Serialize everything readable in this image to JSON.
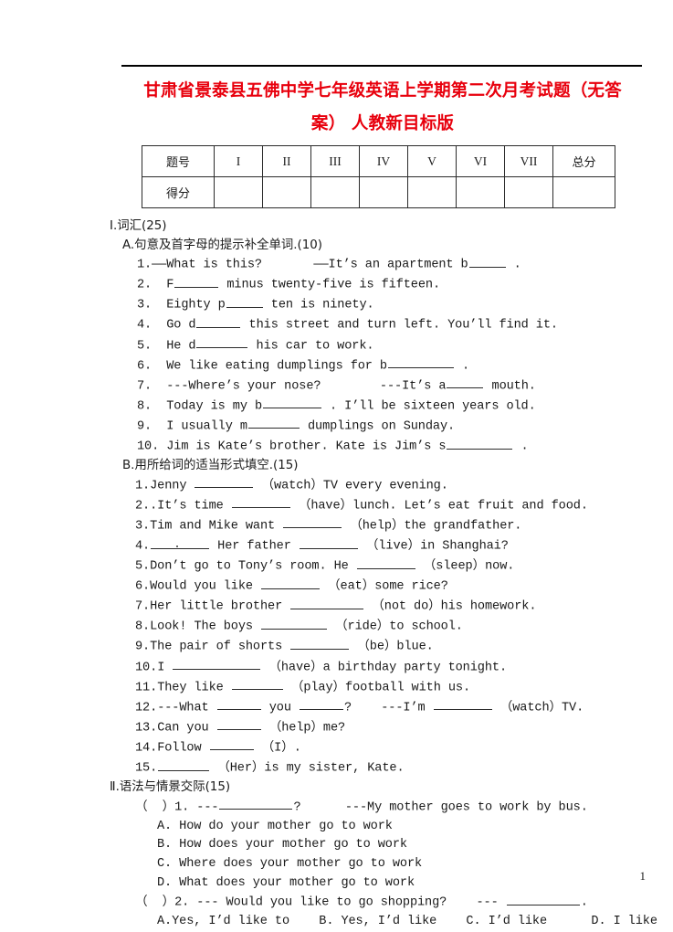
{
  "document": {
    "title_line_1": "甘肃省景泰县五佛中学七年级英语上学期第二次月考试题（无答",
    "title_line_2": "案） 人教新目标版",
    "page_number": "1",
    "title_color": "#e8000d"
  },
  "score_table": {
    "row_label_1": "题号",
    "row_label_2": "得分",
    "columns": [
      "I",
      "II",
      "III",
      "IV",
      "V",
      "VI",
      "VII"
    ],
    "total_label": "总分"
  },
  "section_1": {
    "heading": "Ⅰ.词汇(25)",
    "part_a": {
      "heading": "A.句意及首字母的提示补全单词.(10)",
      "items": [
        {
          "num": "1.",
          "pre": "——What is this?       ——It’s an apartment b",
          "blank": "b5",
          "post": " ."
        },
        {
          "num": "2.",
          "pre": "F",
          "blank": "b6",
          "post": " minus twenty-five is fifteen."
        },
        {
          "num": "3.",
          "pre": "Eighty p",
          "blank": "b5",
          "post": " ten is ninety."
        },
        {
          "num": "4.",
          "pre": "Go d",
          "blank": "b6",
          "post": " this street and turn left. You’ll find it."
        },
        {
          "num": "5.",
          "pre": "He d",
          "blank": "b7",
          "post": " his car to work."
        },
        {
          "num": "6.",
          "pre": "We like eating dumplings for b",
          "blank": "b9",
          "post": " ."
        },
        {
          "num": "7.",
          "pre": "---Where’s your nose?        ---It’s a",
          "blank": "b5",
          "post": " mouth."
        },
        {
          "num": "8.",
          "pre": "Today is my b",
          "blank": "b8",
          "post": " . I’ll be sixteen years old."
        },
        {
          "num": "9.",
          "pre": "I usually m",
          "blank": "b7",
          "post": " dumplings on Sunday."
        },
        {
          "num": "10.",
          "pre": "Jim is Kate’s brother. Kate is Jim’s s",
          "blank": "b9",
          "post": " ."
        }
      ]
    },
    "part_b": {
      "heading": "B.用所给词的适当形式填空.(15)",
      "items": [
        {
          "num": "1.",
          "pre": "Jenny ",
          "blank": "b8",
          "post": " （watch）TV every evening."
        },
        {
          "num": "2.",
          "pre": ".It’s time ",
          "blank": "b8",
          "post": " （have）lunch. Let’s eat fruit and food."
        },
        {
          "num": "3.",
          "pre": "Tim and Mike want ",
          "blank": "b8",
          "post": " （help）the grandfather."
        },
        {
          "num": "4.",
          "pre": "",
          "blank": "b8dot",
          "post": " Her father ",
          "blank2": "b8",
          "post2": " （live）in Shanghai?"
        },
        {
          "num": "5.",
          "pre": "Don’t go to Tony’s room. He ",
          "blank": "b8",
          "post": " （sleep）now."
        },
        {
          "num": "6.",
          "pre": "Would you like ",
          "blank": "b8",
          "post": " （eat）some rice?"
        },
        {
          "num": "7.",
          "pre": "Her little brother ",
          "blank": "b10",
          "post": " （not do）his homework."
        },
        {
          "num": "8.",
          "pre": "Look! The boys ",
          "blank": "b9",
          "post": " （ride）to school."
        },
        {
          "num": "9.",
          "pre": "The pair of shorts ",
          "blank": "b8",
          "post": " （be）blue."
        },
        {
          "num": "10.",
          "pre": "I ",
          "blank": "b12",
          "post": " （have）a birthday party tonight."
        },
        {
          "num": "11.",
          "pre": "They like ",
          "blank": "b7",
          "post": " （play）football with us."
        },
        {
          "num": "12.",
          "pre": "---What ",
          "blank": "b6",
          "post": " you ",
          "blank2": "b6",
          "post2": "?    ---I’m ",
          "blank3": "b8",
          "post3": " （watch）TV."
        },
        {
          "num": "13.",
          "pre": "Can you ",
          "blank": "b6",
          "post": " （help）me?"
        },
        {
          "num": "14.",
          "pre": "Follow ",
          "blank": "b6",
          "post": " （I）."
        },
        {
          "num": "15.",
          "pre": "",
          "blank": "b7",
          "post": " （Her）is my sister, Kate."
        }
      ]
    }
  },
  "section_2": {
    "heading": "Ⅱ.语法与情景交际(15)",
    "questions": [
      {
        "marker": "（  ）1.",
        "stem_pre": " ---",
        "stem_blank": "b10",
        "stem_post": "?      ---My mother goes to work by bus.",
        "options": [
          "A. How do your mother go to work",
          "B. How does your mother go to work",
          "C. Where does your mother go to work",
          "D. What does your mother go to work"
        ]
      },
      {
        "marker": "（  ）2.",
        "stem_pre": " --- Would you like to go shopping?    --- ",
        "stem_blank": "b10",
        "stem_post": ".",
        "options_inline": "A.Yes, I’d like to    B. Yes, I’d like    C. I’d like      D. I like"
      }
    ]
  }
}
